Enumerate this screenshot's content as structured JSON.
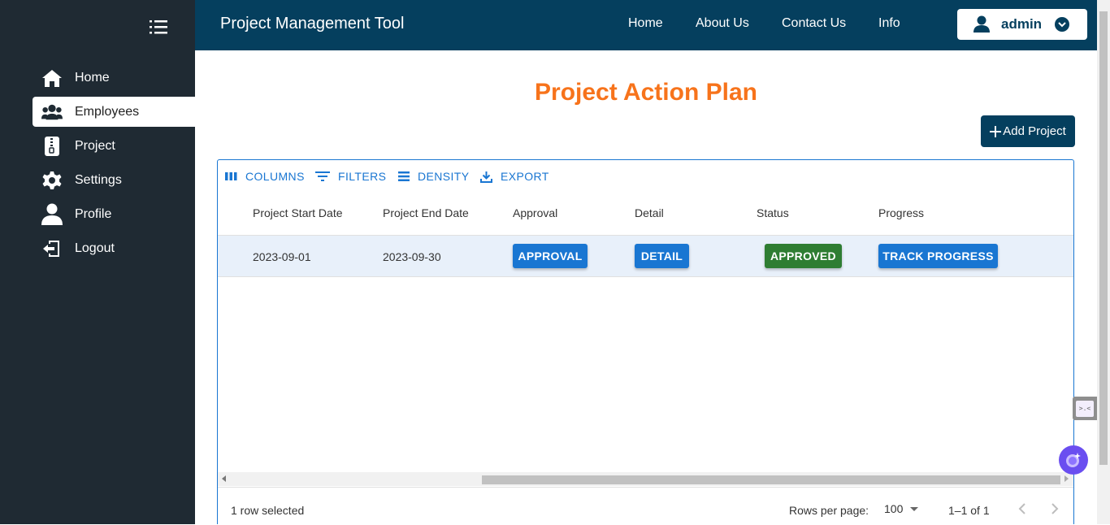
{
  "sidebar": {
    "items": [
      {
        "label": "Home",
        "icon": "home-icon"
      },
      {
        "label": "Employees",
        "icon": "users-icon"
      },
      {
        "label": "Project",
        "icon": "zip-file-icon"
      },
      {
        "label": "Settings",
        "icon": "gear-icon"
      },
      {
        "label": "Profile",
        "icon": "user-icon"
      },
      {
        "label": "Logout",
        "icon": "logout-icon"
      }
    ],
    "active": "Employees"
  },
  "header": {
    "title": "Project Management Tool",
    "nav": [
      "Home",
      "About Us",
      "Contact Us",
      "Info"
    ],
    "user": "admin"
  },
  "main": {
    "title": "Project Action Plan",
    "add_button": "Add Project"
  },
  "grid": {
    "toolbar": [
      "COLUMNS",
      "FILTERS",
      "DENSITY",
      "EXPORT"
    ],
    "columns": [
      "Project Start Date",
      "Project End Date",
      "Approval",
      "Detail",
      "Status",
      "Progress"
    ],
    "rows": [
      {
        "start_date": "2023-09-01",
        "end_date": "2023-09-30",
        "approval": "APPROVAL",
        "detail": "DETAIL",
        "status": "APPROVED",
        "progress": "TRACK PROGRESS"
      }
    ],
    "footer": {
      "selected": "1 row selected",
      "rows_per_page_label": "Rows per page:",
      "rows_per_page": "100",
      "range": "1–1 of 1"
    }
  },
  "colors": {
    "sidebar": "#1f2a33",
    "topbar": "#053f5e",
    "title": "#f7731b",
    "primary": "#1976d2",
    "success": "#2e7d32",
    "row_selected": "#e8f0fa"
  },
  "widgets": {
    "side_widget_glyph": ">.<"
  }
}
